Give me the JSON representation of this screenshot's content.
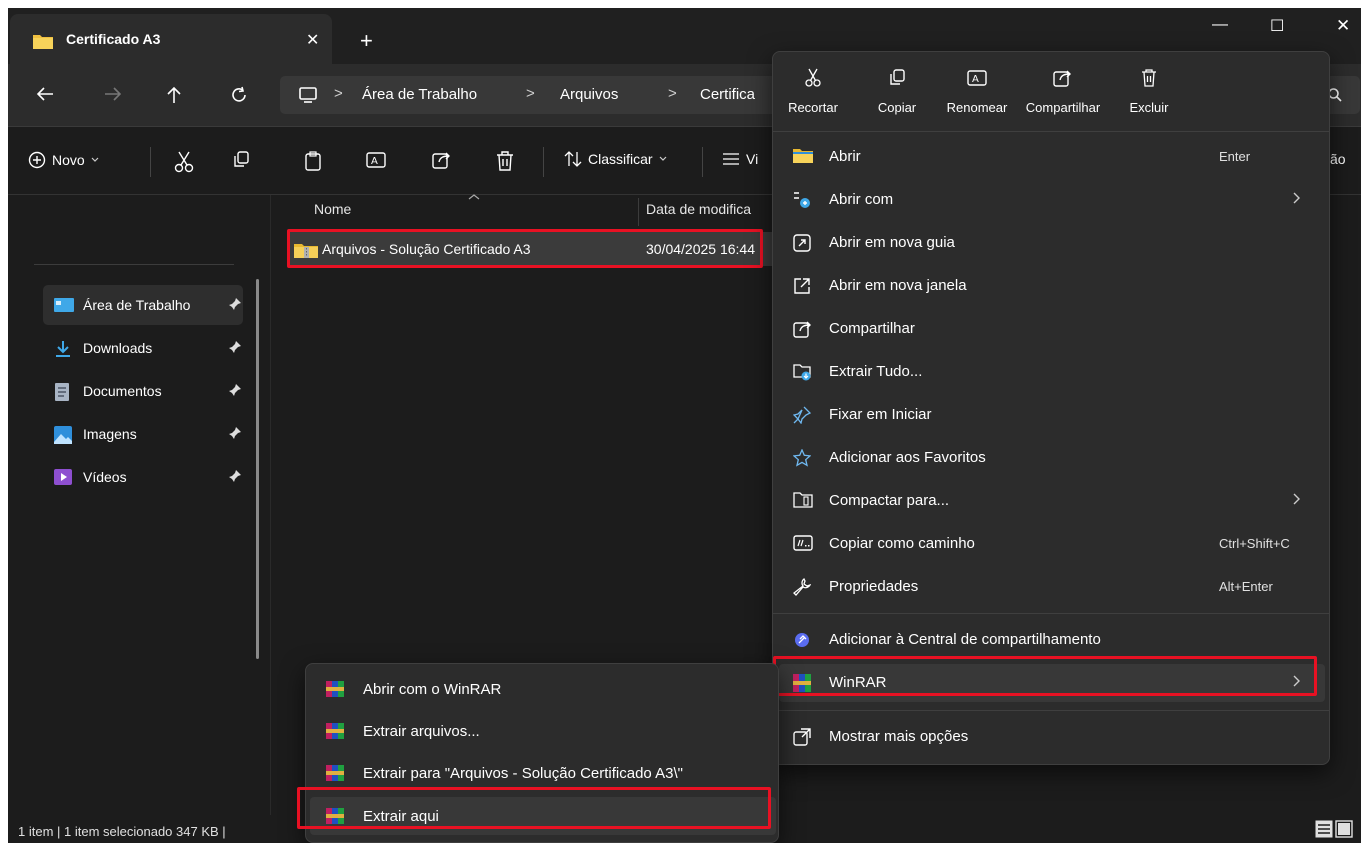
{
  "tab": {
    "title": "Certificado A3",
    "close_glyph": "✕",
    "new_tab_glyph": "+"
  },
  "window_controls": {
    "minimize": "—",
    "maximize": "☐",
    "close": "✕"
  },
  "address": {
    "crumbs": [
      "Área de Trabalho",
      "Arquivos",
      "Certifica"
    ],
    "separator": ">"
  },
  "toolbar": {
    "new_label": "Novo",
    "sort_label": "Classificar",
    "view_label": "Vi",
    "partial_right": "ão"
  },
  "sidebar": {
    "items": [
      {
        "label": "Área de Trabalho",
        "icon": "desktop-icon"
      },
      {
        "label": "Downloads",
        "icon": "download-icon"
      },
      {
        "label": "Documentos",
        "icon": "document-icon"
      },
      {
        "label": "Imagens",
        "icon": "image-icon"
      },
      {
        "label": "Vídeos",
        "icon": "video-icon"
      }
    ]
  },
  "columns": {
    "name": "Nome",
    "date": "Data de modifica"
  },
  "file": {
    "name": "Arquivos - Solução Certificado A3",
    "date": "30/04/2025 16:44"
  },
  "status": {
    "text": "1 item  |  1 item selecionado  347 KB  |"
  },
  "context_menu": {
    "quick_actions": [
      "Recortar",
      "Copiar",
      "Renomear",
      "Compartilhar",
      "Excluir"
    ],
    "items": [
      {
        "label": "Abrir",
        "shortcut": "Enter"
      },
      {
        "label": "Abrir com",
        "arrow": "›"
      },
      {
        "label": "Abrir em nova guia"
      },
      {
        "label": "Abrir em nova janela"
      },
      {
        "label": "Compartilhar"
      },
      {
        "label": "Extrair Tudo..."
      },
      {
        "label": "Fixar em Iniciar"
      },
      {
        "label": "Adicionar aos Favoritos"
      },
      {
        "label": "Compactar para...",
        "arrow": "›"
      },
      {
        "label": "Copiar como caminho",
        "shortcut": "Ctrl+Shift+C"
      },
      {
        "label": "Propriedades",
        "shortcut": "Alt+Enter"
      },
      {
        "label": "Adicionar à Central de compartilhamento"
      },
      {
        "label": "WinRAR",
        "arrow": "›"
      },
      {
        "label": "Mostrar mais opções"
      }
    ]
  },
  "winrar_submenu": {
    "items": [
      "Abrir com o WinRAR",
      "Extrair arquivos...",
      "Extrair para \"Arquivos - Solução Certificado A3\\\"",
      "Extrair aqui"
    ]
  },
  "colors": {
    "highlight_box": "#e81123",
    "folder_yellow": "#f0c040",
    "background": "#1c1c1c",
    "menu_bg": "#2c2c2c"
  }
}
